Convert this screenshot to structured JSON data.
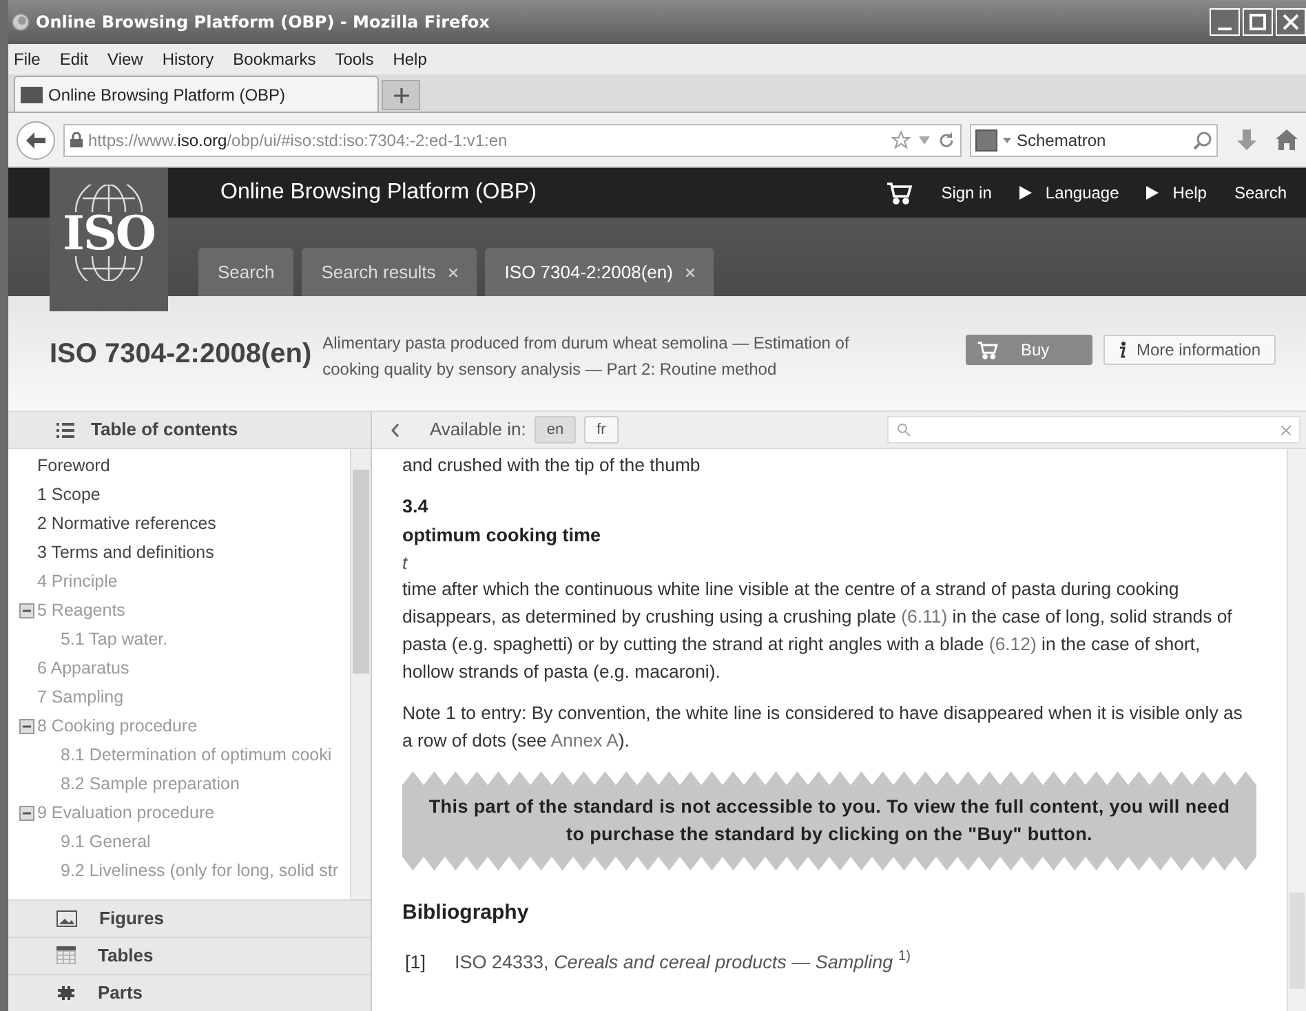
{
  "window": {
    "title": "Online Browsing Platform (OBP) - Mozilla Firefox"
  },
  "menu": [
    "File",
    "Edit",
    "View",
    "History",
    "Bookmarks",
    "Tools",
    "Help"
  ],
  "browser_tabs": [
    {
      "label": "Online Browsing Platform (OBP)",
      "selected": true
    }
  ],
  "address_bar": {
    "prefix": "https://www.",
    "domain": "iso.org",
    "path": "/obp/ui/#iso:std:iso:7304:-2:ed-1:v1:en"
  },
  "search_box": {
    "value": "Schematron"
  },
  "site": {
    "logo_text": "ISO",
    "title": "Online Browsing Platform (OBP)",
    "nav": [
      {
        "label": "Sign in",
        "kind": "cart"
      },
      {
        "label": "Language",
        "kind": "arrow"
      },
      {
        "label": "Help",
        "kind": "arrow"
      },
      {
        "label": "Search",
        "kind": "plain"
      }
    ]
  },
  "site_tabs": [
    {
      "label": "Search",
      "closable": false,
      "selected": false
    },
    {
      "label": "Search results",
      "closable": true,
      "selected": false
    },
    {
      "label": "ISO 7304-2:2008(en)",
      "closable": true,
      "selected": true
    }
  ],
  "document": {
    "code": "ISO 7304-2:2008(en)",
    "title": "Alimentary pasta produced from durum wheat semolina — Estimation of cooking quality by sensory analysis — Part 2: Routine method",
    "buy": "Buy",
    "more": "More information"
  },
  "toc": {
    "title": "Table of contents",
    "items": [
      {
        "label": "Foreword",
        "accessible": true
      },
      {
        "label": "1 Scope",
        "accessible": true
      },
      {
        "label": "2 Normative references",
        "accessible": true
      },
      {
        "label": "3 Terms and definitions",
        "accessible": true
      },
      {
        "label": "4 Principle",
        "accessible": false
      },
      {
        "label": "5 Reagents",
        "accessible": false,
        "expanded": true,
        "children": [
          {
            "label": "5.1 Tap water.",
            "accessible": false
          }
        ]
      },
      {
        "label": "6 Apparatus",
        "accessible": false
      },
      {
        "label": "7 Sampling",
        "accessible": false
      },
      {
        "label": "8 Cooking procedure",
        "accessible": false,
        "expanded": true,
        "children": [
          {
            "label": "8.1 Determination of optimum cooki",
            "accessible": false
          },
          {
            "label": "8.2 Sample preparation",
            "accessible": false
          }
        ]
      },
      {
        "label": "9 Evaluation procedure",
        "accessible": false,
        "expanded": true,
        "children": [
          {
            "label": "9.1 General",
            "accessible": false
          },
          {
            "label": "9.2 Liveliness (only for long, solid str",
            "accessible": false
          }
        ]
      }
    ]
  },
  "sidebar_sections": [
    {
      "label": "Figures",
      "kind": "figures"
    },
    {
      "label": "Tables",
      "kind": "tables"
    },
    {
      "label": "Parts",
      "kind": "parts"
    }
  ],
  "languages": {
    "label": "Available in:",
    "items": [
      {
        "label": "en",
        "selected": true
      },
      {
        "label": "fr",
        "selected": false
      }
    ]
  },
  "content": [
    {
      "kind": "text",
      "parts": [
        {
          "text": "and crushed with the tip of the thumb"
        }
      ]
    },
    {
      "kind": "term_number",
      "text": "3.4"
    },
    {
      "kind": "term",
      "text": "optimum cooking time"
    },
    {
      "kind": "symbol",
      "text": "t"
    },
    {
      "kind": "text",
      "parts": [
        {
          "text": "time after which the continuous white line visible at the centre of a strand of pasta during cooking disappears, as determined by crushing using a crushing plate "
        },
        {
          "text": "(6.11)",
          "link": true
        },
        {
          "text": " in the case of long, solid strands of pasta (e.g. spaghetti) or by cutting the strand at right angles with a blade "
        },
        {
          "text": "(6.12)",
          "link": true
        },
        {
          "text": " in the case of short, hollow strands of pasta (e.g. macaroni)."
        }
      ]
    },
    {
      "kind": "note",
      "parts": [
        {
          "text": "Note 1 to entry: By convention, the white line is considered to have disappeared when it is visible only as a row of dots (see "
        },
        {
          "text": "Annex A",
          "link": true
        },
        {
          "text": ")."
        }
      ]
    },
    {
      "kind": "banner",
      "text": "This part of the standard is not accessible to you. To view the full content, you will need to purchase the standard by clicking on the \"Buy\" button."
    },
    {
      "kind": "heading",
      "text": "Bibliography"
    },
    {
      "kind": "reference",
      "number": "[1]",
      "text": "ISO 24333, *Cereals and cereal products — Sampling* $^{1)}$"
    }
  ]
}
